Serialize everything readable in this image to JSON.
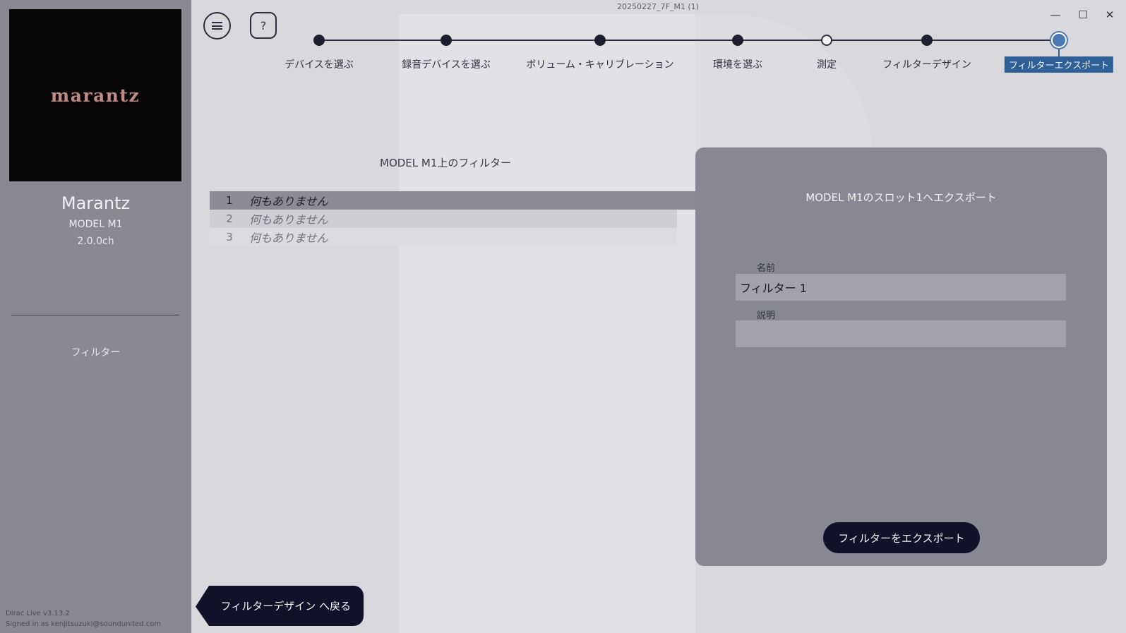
{
  "window": {
    "title": "20250227_7F_M1 (1)",
    "minimize_icon": "minimize-icon",
    "maximize_icon": "maximize-icon",
    "close_icon": "close-icon"
  },
  "sidebar": {
    "logo_text": "marantz",
    "brand": "Marantz",
    "model": "MODEL M1",
    "channel": "2.0.0ch",
    "filter_label": "フィルター",
    "version": "Dirac Live v3.13.2",
    "signed_in": "Signed in as kenjitsuzuki@soundunited.com"
  },
  "toolbar": {
    "menu_icon": "menu-icon",
    "help_label": "?"
  },
  "steps": [
    {
      "label": "デバイスを選ぶ",
      "state": "done"
    },
    {
      "label": "録音デバイスを選ぶ",
      "state": "done"
    },
    {
      "label": "ボリューム・キャリブレーション",
      "state": "done"
    },
    {
      "label": "環境を選ぶ",
      "state": "done"
    },
    {
      "label": "測定",
      "state": "hollow"
    },
    {
      "label": "フィルターデザイン",
      "state": "done"
    },
    {
      "label": "フィルターエクスポート",
      "state": "active"
    }
  ],
  "filters": {
    "title": "MODEL M1上のフィルター",
    "rows": [
      {
        "num": "1",
        "text": "何もありません"
      },
      {
        "num": "2",
        "text": "何もありません"
      },
      {
        "num": "3",
        "text": "何もありません"
      }
    ]
  },
  "export": {
    "title": "MODEL M1のスロット1へエクスポート",
    "name_label": "名前",
    "name_value": "フィルター 1",
    "desc_label": "説明",
    "desc_value": "",
    "button_label": "フィルターをエクスポート"
  },
  "nav": {
    "back_label": "フィルターデザイン へ戻る"
  },
  "colors": {
    "accent": "#4a78b0",
    "dark_button": "#111229",
    "sidebar": "#8a8890",
    "panel": "#878894"
  }
}
